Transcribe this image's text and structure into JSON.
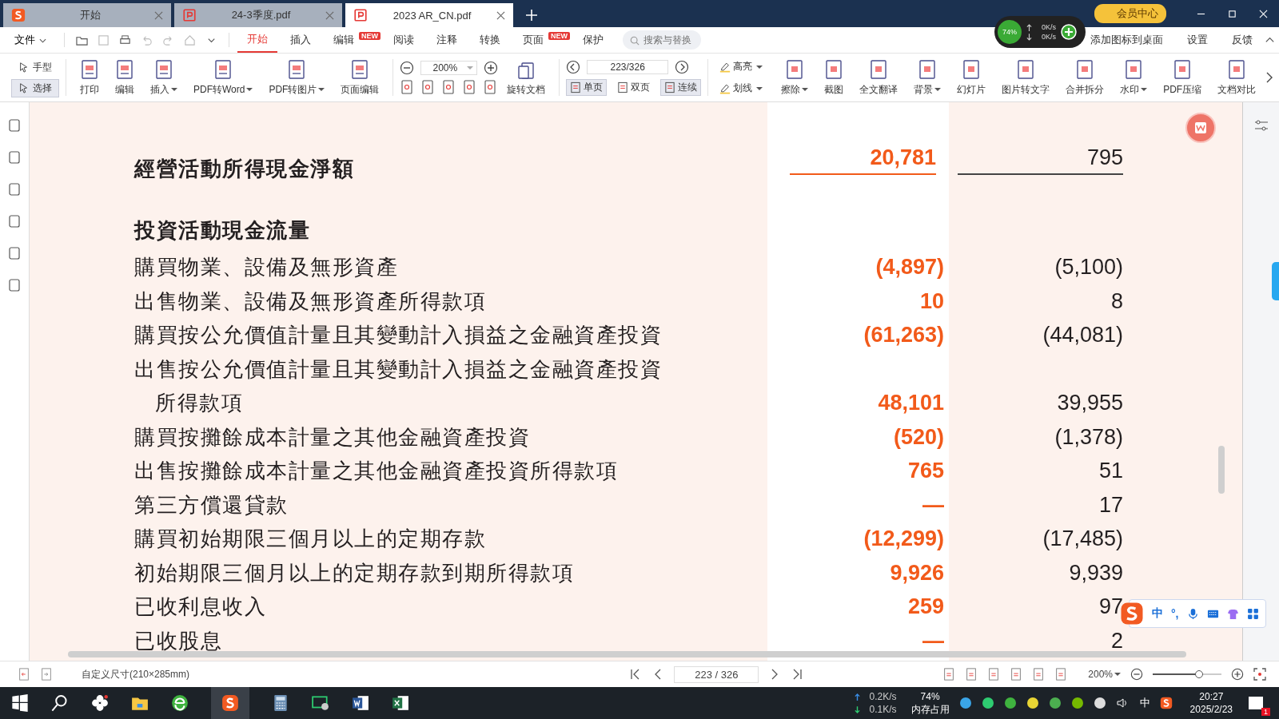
{
  "tabs": [
    {
      "label": "开始",
      "selected": false,
      "kind": "home"
    },
    {
      "label": "24-3季度.pdf",
      "selected": false,
      "kind": "pdf"
    },
    {
      "label": "2023 AR_CN.pdf",
      "selected": true,
      "kind": "pdf"
    }
  ],
  "vip": "会员中心",
  "net_widget": {
    "percent": "74%",
    "up": "0K/s",
    "down": "0K/s"
  },
  "menu": {
    "file": "文件",
    "tabs": [
      {
        "label": "开始",
        "selected": true
      },
      {
        "label": "插入",
        "selected": false
      },
      {
        "label": "编辑",
        "selected": false,
        "badge": "NEW"
      },
      {
        "label": "阅读",
        "selected": false
      },
      {
        "label": "注释",
        "selected": false
      },
      {
        "label": "转换",
        "selected": false
      },
      {
        "label": "页面",
        "selected": false,
        "badge": "NEW"
      },
      {
        "label": "保护",
        "selected": false
      }
    ],
    "search": {
      "placeholder": "搜索与替换"
    },
    "links": [
      "添加图标到桌面",
      "设置",
      "反馈"
    ]
  },
  "toolbar": {
    "modes": [
      {
        "label": "手型",
        "selected": false
      },
      {
        "label": "选择",
        "selected": true
      }
    ],
    "tools_a": [
      {
        "label": "打印",
        "dropdown": false
      },
      {
        "label": "编辑",
        "dropdown": false
      },
      {
        "label": "插入",
        "dropdown": true
      },
      {
        "label": "PDF转Word",
        "dropdown": true
      },
      {
        "label": "PDF转图片",
        "dropdown": true
      },
      {
        "label": "页面编辑",
        "dropdown": false
      }
    ],
    "zoom": "200%",
    "rotate": "旋转文档",
    "page": "223/326",
    "views": [
      {
        "label": "单页",
        "selected": true
      },
      {
        "label": "双页",
        "selected": false
      },
      {
        "label": "连续",
        "selected": true
      }
    ],
    "marks": [
      {
        "label": "高亮",
        "dropdown": true
      },
      {
        "label": "划线",
        "dropdown": true
      }
    ],
    "tools_b": [
      {
        "label": "擦除",
        "dropdown": true
      },
      {
        "label": "截图",
        "dropdown": false
      },
      {
        "label": "全文翻译",
        "dropdown": false
      },
      {
        "label": "背景",
        "dropdown": true
      },
      {
        "label": "幻灯片",
        "dropdown": false
      },
      {
        "label": "图片转文字",
        "dropdown": false
      },
      {
        "label": "合并拆分",
        "dropdown": false
      },
      {
        "label": "水印",
        "dropdown": true
      },
      {
        "label": "PDF压缩",
        "dropdown": false
      },
      {
        "label": "文档对比",
        "dropdown": false
      }
    ]
  },
  "statement": {
    "rows": [
      {
        "kind": "total",
        "label": "經營活動所得現金淨額",
        "current": "20,781",
        "prior": "795"
      },
      {
        "kind": "heading",
        "label": "投資活動現金流量"
      },
      {
        "kind": "item",
        "label": "購買物業、設備及無形資產",
        "current": "(4,897)",
        "prior": "(5,100)"
      },
      {
        "kind": "item",
        "label": "出售物業、設備及無形資產所得款項",
        "current": "10",
        "prior": "8"
      },
      {
        "kind": "item",
        "label": "購買按公允價值計量且其變動計入損益之金融資產投資",
        "current": "(61,263)",
        "prior": "(44,081)"
      },
      {
        "kind": "item",
        "label": "出售按公允價值計量且其變動計入損益之金融資產投資"
      },
      {
        "kind": "continued",
        "label": "所得款項",
        "current": "48,101",
        "prior": "39,955"
      },
      {
        "kind": "item",
        "label": "購買按攤餘成本計量之其他金融資產投資",
        "current": "(520)",
        "prior": "(1,378)"
      },
      {
        "kind": "item",
        "label": "出售按攤餘成本計量之其他金融資產投資所得款項",
        "current": "765",
        "prior": "51"
      },
      {
        "kind": "item",
        "label": "第三方償還貸款",
        "current": "—",
        "prior": "17"
      },
      {
        "kind": "item",
        "label": "購買初始期限三個月以上的定期存款",
        "current": "(12,299)",
        "prior": "(17,485)"
      },
      {
        "kind": "item",
        "label": "初始期限三個月以上的定期存款到期所得款項",
        "current": "9,926",
        "prior": "9,939"
      },
      {
        "kind": "item",
        "label": "已收利息收入",
        "current": "259",
        "prior": "97"
      },
      {
        "kind": "item",
        "label": "已收股息",
        "current": "—",
        "prior": "2"
      }
    ]
  },
  "status_bar": {
    "page_size": "自定义尺寸(210×285mm)",
    "page": "223 / 326",
    "zoom": "200%",
    "zoom_slider": {
      "level": 0.68
    }
  },
  "ime": {
    "mode": "中",
    "punct": "°,"
  },
  "taskbar": {
    "upload": "0.2K/s",
    "download": "0.1K/s",
    "memory": "74%",
    "memory_label": "内存占用",
    "lang": "中",
    "time": "20:27",
    "date": "2025/2/23",
    "notifications": "1"
  }
}
